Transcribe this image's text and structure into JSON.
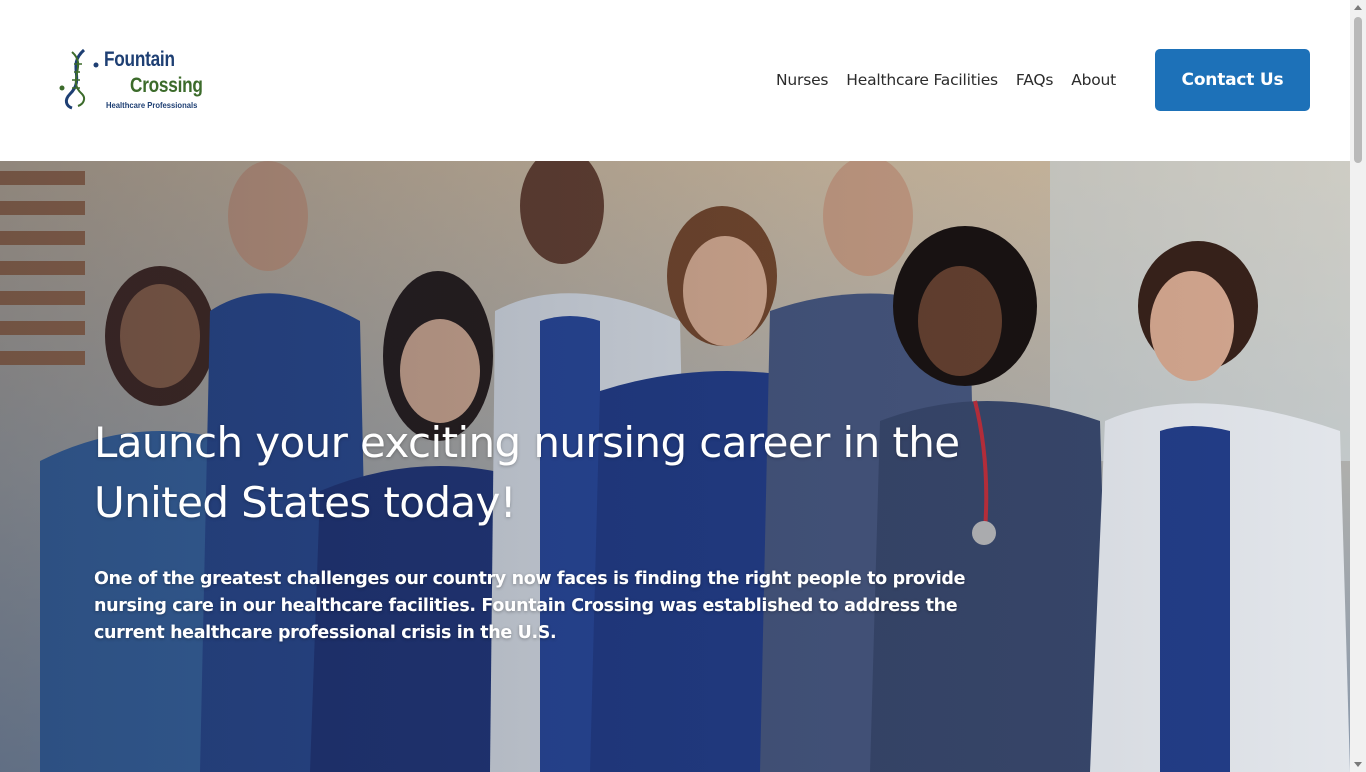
{
  "brand": {
    "line1": "Fountain",
    "line2": "Crossing",
    "tagline": "Healthcare Professionals",
    "colors": {
      "navy": "#1e3f73",
      "green": "#3c6b2b"
    }
  },
  "nav": {
    "items": [
      {
        "label": "Nurses"
      },
      {
        "label": "Healthcare Facilities"
      },
      {
        "label": "FAQs"
      },
      {
        "label": "About"
      }
    ],
    "cta_label": "Contact Us",
    "cta_color": "#1d71b8"
  },
  "hero": {
    "title": "Launch your exciting nursing career in the United States today!",
    "body": "One of the greatest challenges our country now faces is finding the right people to provide nursing care in our healthcare facilities. Fountain Crossing was established to address the current healthcare professional crisis in the U.S.",
    "image_icon": "group-of-healthcare-workers-photo"
  }
}
